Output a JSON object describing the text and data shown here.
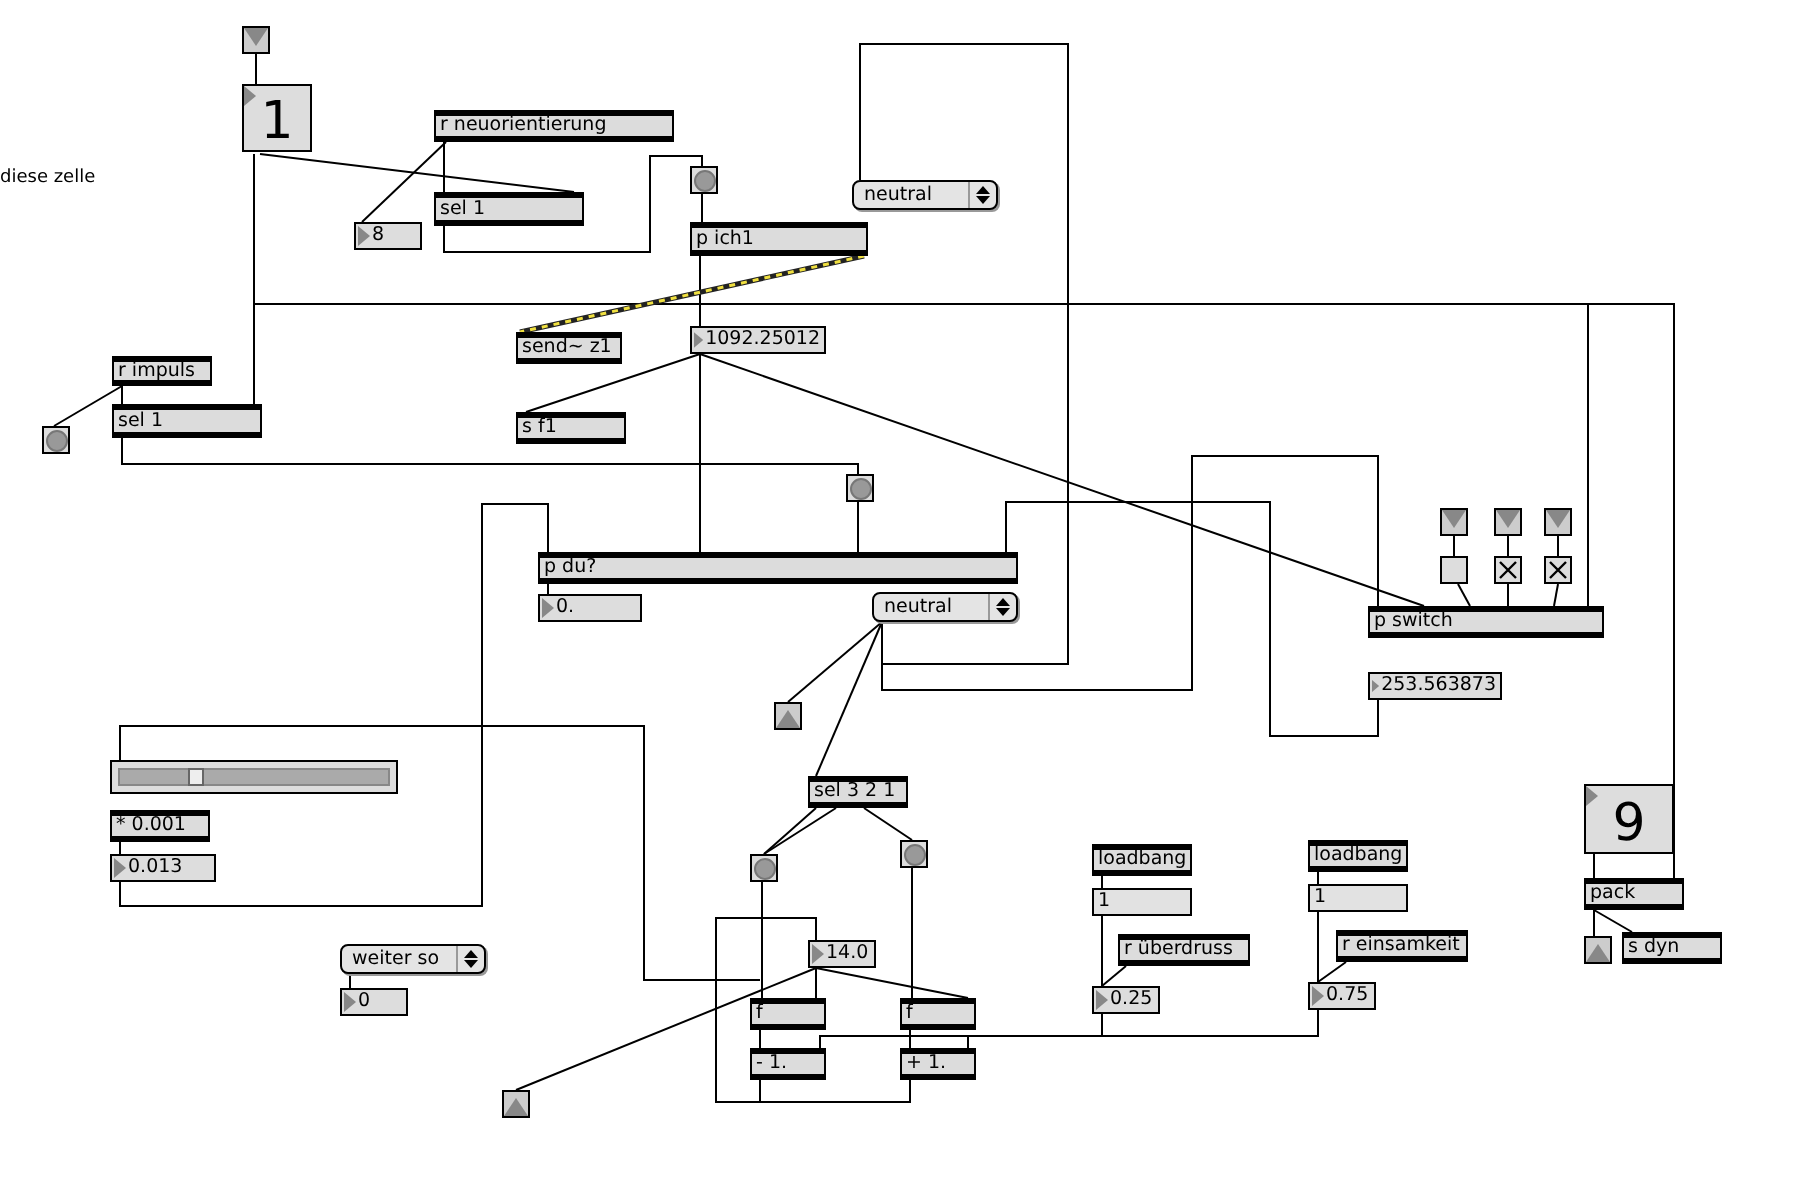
{
  "patcher": {
    "comment": "diese zelle",
    "objects": [
      {
        "kind": "inlet"
      },
      {
        "kind": "bignumber",
        "text": "1"
      },
      {
        "kind": "object",
        "text": "r neuorientierung"
      },
      {
        "kind": "object",
        "text": "sel 1"
      },
      {
        "kind": "number",
        "text": "8"
      },
      {
        "kind": "bang"
      },
      {
        "kind": "object",
        "text": "p ich1"
      },
      {
        "kind": "umenu",
        "text": "neutral"
      },
      {
        "kind": "object",
        "text": "send~ z1"
      },
      {
        "kind": "number",
        "text": "1092.25012"
      },
      {
        "kind": "object",
        "text": "r impuls"
      },
      {
        "kind": "object",
        "text": "sel 1"
      },
      {
        "kind": "bang"
      },
      {
        "kind": "object",
        "text": "s f1"
      },
      {
        "kind": "bang"
      },
      {
        "kind": "object",
        "text": "p du?"
      },
      {
        "kind": "number",
        "text": "0."
      },
      {
        "kind": "umenu",
        "text": "neutral"
      },
      {
        "kind": "inlet"
      },
      {
        "kind": "inlet"
      },
      {
        "kind": "inlet"
      },
      {
        "kind": "toggle",
        "checked": false
      },
      {
        "kind": "toggle",
        "checked": true
      },
      {
        "kind": "toggle",
        "checked": true
      },
      {
        "kind": "object",
        "text": "p switch"
      },
      {
        "kind": "number",
        "text": "253.563873"
      },
      {
        "kind": "outlet"
      },
      {
        "kind": "slider",
        "level": 0.27
      },
      {
        "kind": "object",
        "text": "* 0.001"
      },
      {
        "kind": "number",
        "text": "0.013"
      },
      {
        "kind": "object",
        "text": "sel 3 2 1"
      },
      {
        "kind": "bang"
      },
      {
        "kind": "bang"
      },
      {
        "kind": "umenu",
        "text": "weiter so"
      },
      {
        "kind": "number",
        "text": "14.0"
      },
      {
        "kind": "number",
        "text": "0"
      },
      {
        "kind": "object",
        "text": "f"
      },
      {
        "kind": "object",
        "text": "- 1."
      },
      {
        "kind": "object",
        "text": "f"
      },
      {
        "kind": "object",
        "text": "+ 1."
      },
      {
        "kind": "outlet"
      },
      {
        "kind": "object",
        "text": "loadbang"
      },
      {
        "kind": "message",
        "text": "1"
      },
      {
        "kind": "object",
        "text": "r überdruss"
      },
      {
        "kind": "number",
        "text": "0.25"
      },
      {
        "kind": "object",
        "text": "loadbang"
      },
      {
        "kind": "message",
        "text": "1"
      },
      {
        "kind": "object",
        "text": "r einsamkeit"
      },
      {
        "kind": "number",
        "text": "0.75"
      },
      {
        "kind": "bignumber",
        "text": "9"
      },
      {
        "kind": "object",
        "text": "pack"
      },
      {
        "kind": "outlet"
      },
      {
        "kind": "object",
        "text": "s dyn"
      }
    ]
  }
}
